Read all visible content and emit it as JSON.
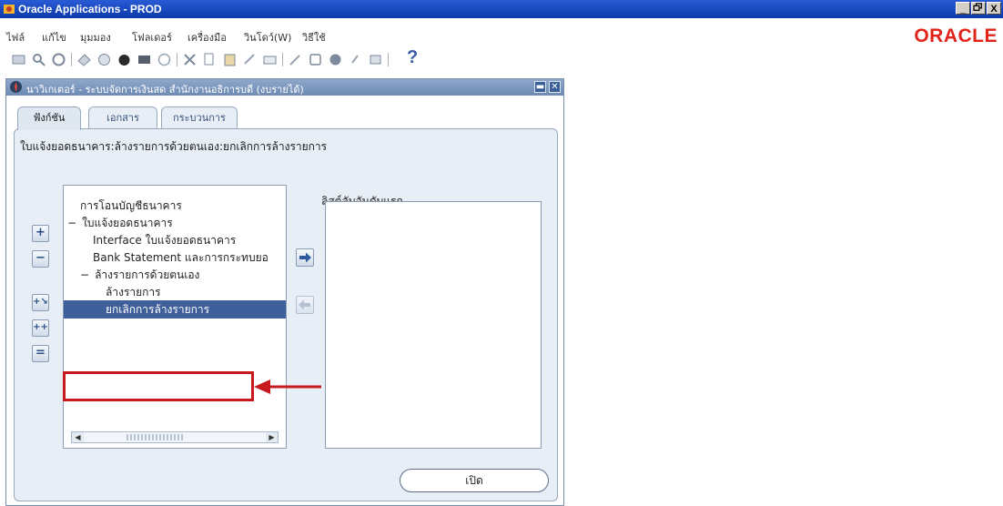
{
  "window": {
    "title": "Oracle Applications - PROD",
    "controls": [
      "_",
      "̸",
      "X"
    ]
  },
  "menu": {
    "items": [
      "ไฟล์",
      "แก้ไข",
      "มุมมอง",
      "โฟลเดอร์",
      "เครื่องมือ",
      "วินโดว์(W)",
      "วิธีใช้"
    ]
  },
  "brand": {
    "logo_text": "ORACLE",
    "color": "#e2231a"
  },
  "toolbar": {
    "icons": [
      "new-icon",
      "find-icon",
      "navigator-icon",
      "save-icon",
      "next-step-icon",
      "print-icon",
      "close-form-icon",
      "cut-icon",
      "copy-icon",
      "paste-icon",
      "clear-record-icon",
      "delete-icon",
      "edit-field-icon",
      "zoom-icon",
      "translations-icon",
      "attachments-icon",
      "folder-tools-icon"
    ],
    "help_label": "?"
  },
  "navigator": {
    "title": "นาวิเกเตอร์ - ระบบจัดการเงินสด สำนักงานอธิการบดี (งบรายได้)",
    "tabs": [
      {
        "label": "ฟังก์ชัน",
        "active": true
      },
      {
        "label": "เอกสาร",
        "active": false
      },
      {
        "label": "กระบวนการ",
        "active": false
      }
    ],
    "panel_title": "ใบแจ้งยอดธนาคาร:ล้างรายการด้วยตนเอง:ยกเลิกการล้างรายการ",
    "side_buttons": [
      "+",
      "−",
      "+↘",
      "++",
      "="
    ],
    "tree": [
      {
        "label": "การโอนบัญชีธนาคาร",
        "prefix": "",
        "selected": false
      },
      {
        "label": "ใบแจ้งยอดธนาคาร",
        "prefix": "−",
        "selected": false
      },
      {
        "label": "Interface ใบแจ้งยอดธนาคาร",
        "prefix": "",
        "selected": false
      },
      {
        "label": "Bank Statement และการกระทบยอ",
        "prefix": "",
        "selected": false
      },
      {
        "label": "ล้างรายการด้วยตนเอง",
        "prefix": "−",
        "selected": false
      },
      {
        "label": "ล้างรายการ",
        "prefix": "",
        "selected": false
      },
      {
        "label": "ยกเลิกการล้างรายการ",
        "prefix": "",
        "selected": true
      }
    ],
    "first_list_label": "ลิสต์ลับอันดับแรก",
    "first_list_items": [],
    "open_button": "เปิด"
  },
  "colors": {
    "annotation": "#c8191e",
    "selection": "#3f5f9a",
    "titlebar": "#0a3aa8"
  }
}
